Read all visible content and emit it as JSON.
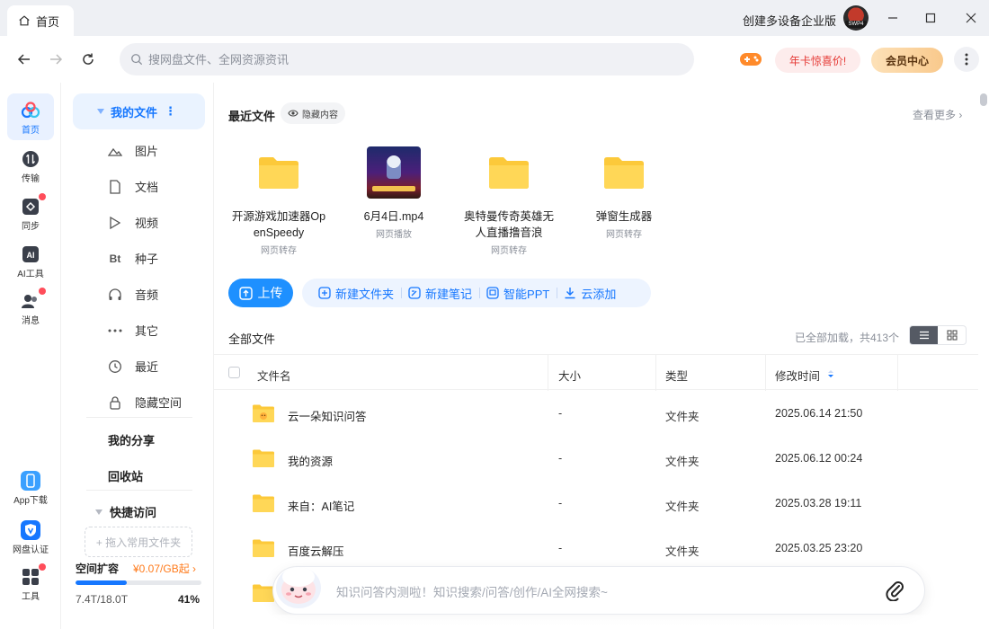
{
  "tab": {
    "label": "首页"
  },
  "titlebar": {
    "company_label": "创建多设备企业版",
    "avatar_badge": "SWP4"
  },
  "search": {
    "placeholder": "搜网盘文件、全网资源资讯"
  },
  "promo": {
    "label": "年卡惊喜价!"
  },
  "vip": {
    "label": "会员中心"
  },
  "rail": {
    "items": [
      {
        "label": "首页",
        "icon": "cloud-icon",
        "active": true
      },
      {
        "label": "传输",
        "icon": "transfer-icon"
      },
      {
        "label": "同步",
        "icon": "sync-icon",
        "dot": true
      },
      {
        "label": "AI工具",
        "icon": "ai-icon"
      },
      {
        "label": "消息",
        "icon": "message-icon",
        "dot": true
      }
    ],
    "bottom": [
      {
        "label": "App下载",
        "icon": "phone-icon"
      },
      {
        "label": "网盘认证",
        "icon": "shield-icon"
      },
      {
        "label": "工具",
        "icon": "grid-icon",
        "dot": true
      }
    ]
  },
  "sidebar": {
    "my_files": "我的文件",
    "sub_items": [
      {
        "label": "图片",
        "icon": "image-icon"
      },
      {
        "label": "文档",
        "icon": "document-icon"
      },
      {
        "label": "视频",
        "icon": "video-icon"
      },
      {
        "label": "种子",
        "icon": "torrent-icon",
        "glyph": "Bt"
      },
      {
        "label": "音频",
        "icon": "headphones-icon"
      },
      {
        "label": "其它",
        "icon": "more-icon"
      },
      {
        "label": "最近",
        "icon": "clock-icon"
      },
      {
        "label": "隐藏空间",
        "icon": "lock-icon"
      }
    ],
    "my_share": "我的分享",
    "recycle": "回收站",
    "quick_access": "快捷访问",
    "drop_hint": "+ 拖入常用文件夹",
    "space": {
      "title": "空间扩容",
      "price": "¥0.07/GB起",
      "used": "7.4T/18.0T",
      "percent_text": "41%",
      "percent": 0.41
    }
  },
  "recent": {
    "title": "最近文件",
    "hide_label": "隐藏内容",
    "see_more": "查看更多",
    "cards": [
      {
        "name": "开源游戏加速器OpenSpeedy",
        "source": "网页转存",
        "kind": "folder"
      },
      {
        "name": "6月4日.mp4",
        "source": "网页播放",
        "kind": "video"
      },
      {
        "name": "奥特曼传奇英雄无人直播撸音浪",
        "source": "网页转存",
        "kind": "folder"
      },
      {
        "name": "弹窗生成器",
        "source": "网页转存",
        "kind": "folder"
      }
    ]
  },
  "actions": {
    "upload": "上传",
    "items": [
      {
        "label": "新建文件夹",
        "icon": "new-folder-icon"
      },
      {
        "label": "新建笔记",
        "icon": "note-icon"
      },
      {
        "label": "智能PPT",
        "icon": "ppt-icon"
      },
      {
        "label": "云添加",
        "icon": "cloud-download-icon"
      }
    ]
  },
  "files": {
    "title": "全部文件",
    "loaded_info": "已全部加载，共413个",
    "columns": {
      "name": "文件名",
      "size": "大小",
      "type": "类型",
      "modified": "修改时间"
    },
    "rows": [
      {
        "name": "云一朵知识问答",
        "size": "-",
        "type": "文件夹",
        "modified": "2025.06.14 21:50",
        "special": true
      },
      {
        "name": "我的资源",
        "size": "-",
        "type": "文件夹",
        "modified": "2025.06.12 00:24"
      },
      {
        "name": "来自：AI笔记",
        "size": "-",
        "type": "文件夹",
        "modified": "2025.03.28 19:11"
      },
      {
        "name": "百度云解压",
        "size": "-",
        "type": "文件夹",
        "modified": "2025.03.25 23:20"
      }
    ]
  },
  "assistant": {
    "placeholder": "知识问答内测啦！知识搜索/问答/创作/AI全网搜索~"
  },
  "colors": {
    "accent": "#1677ff",
    "folder": "#fcc93a",
    "promo": "#e53935",
    "price": "#ff7a1a"
  }
}
